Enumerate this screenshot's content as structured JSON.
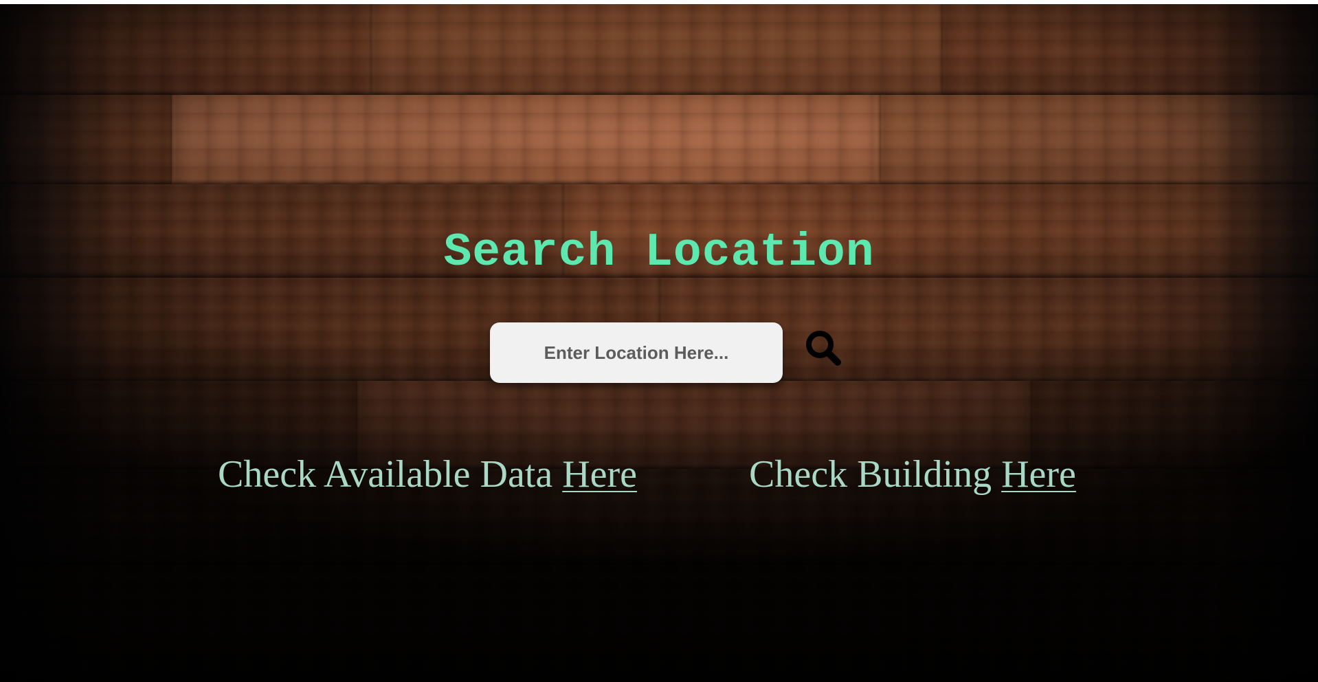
{
  "page": {
    "title": "Search Location"
  },
  "search": {
    "placeholder": "Enter Location Here...",
    "button_icon": "search-icon"
  },
  "links": {
    "data": {
      "prefix": "Check Available Data ",
      "link_label": "Here"
    },
    "building": {
      "prefix": "Check Building ",
      "link_label": "Here"
    }
  },
  "colors": {
    "title": "#5de8b0",
    "link_text": "#a9d8c6",
    "input_background": "#f1f1f1",
    "background_wood": "#6a3a22"
  }
}
